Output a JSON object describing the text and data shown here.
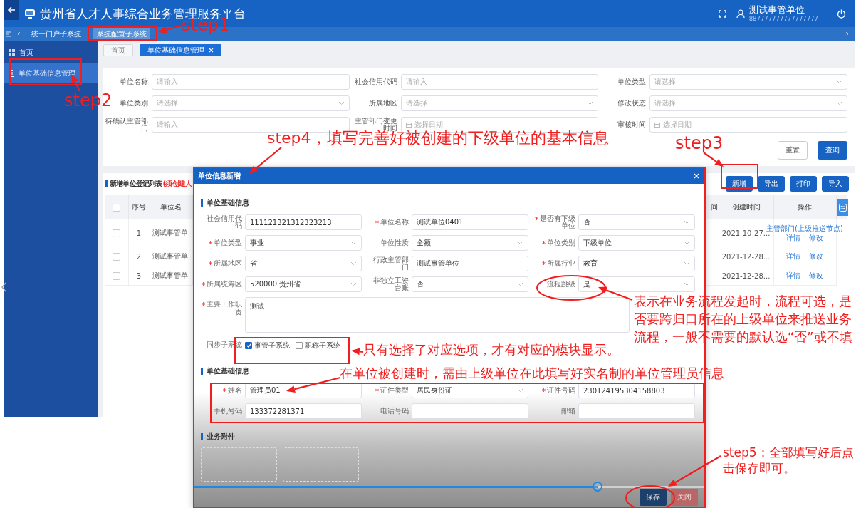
{
  "header": {
    "title": "贵州省人才人事综合业务管理服务平台",
    "user_name": "测试事管单位",
    "user_id": "887777777777777777"
  },
  "subsystem_tabs": [
    {
      "label": "统一门户子系统",
      "selected": false
    },
    {
      "label": "系统配置子系统",
      "selected": true
    }
  ],
  "sidebar": {
    "items": [
      {
        "label": "首页",
        "selected": false
      },
      {
        "label": "单位基础信息管理",
        "selected": true
      }
    ]
  },
  "page_tabs": [
    {
      "label": "首页",
      "selected": false,
      "closable": false
    },
    {
      "label": "单位基础信息管理",
      "selected": true,
      "closable": true
    }
  ],
  "search_form": {
    "fields": [
      {
        "label": "单位名称",
        "kind": "input",
        "placeholder": "请输入"
      },
      {
        "label": "社会信用代码",
        "kind": "input",
        "placeholder": "请输入"
      },
      {
        "label": "单位类型",
        "kind": "select",
        "placeholder": "请选择"
      },
      {
        "label": "单位类别",
        "kind": "select",
        "placeholder": "请选择"
      },
      {
        "label": "所属地区",
        "kind": "select",
        "placeholder": "请选择"
      },
      {
        "label": "修改状态",
        "kind": "select",
        "placeholder": "请选择"
      },
      {
        "label": "待确认主管部门",
        "kind": "input",
        "placeholder": "请输入"
      },
      {
        "label": "主管部门变更时间",
        "kind": "date",
        "placeholder": "选择日期"
      },
      {
        "label": "审核时间",
        "kind": "date",
        "placeholder": "选择日期"
      }
    ],
    "buttons": [
      {
        "label": "重置",
        "primary": false
      },
      {
        "label": "查询",
        "primary": true
      }
    ]
  },
  "list": {
    "title": "新增单位登记列表",
    "note": "(须创建人",
    "buttons": [
      "新增",
      "导出",
      "打印",
      "导入"
    ],
    "all_checked": false,
    "columns": [
      "序号",
      "单位名",
      "间",
      "创建时间",
      "操作"
    ],
    "rows": [
      {
        "checked": false,
        "index": "1",
        "name": "测试事管单",
        "created": "2021-10-27...",
        "actions": [
          "主管部门(上级推送节点)",
          "详情",
          "修改"
        ]
      },
      {
        "checked": false,
        "index": "2",
        "name": "测试事管单",
        "created": "2021-12-28...",
        "actions": [
          "详情",
          "修改"
        ]
      },
      {
        "checked": false,
        "index": "3",
        "name": "测试事管单",
        "created": "2021-12-28...",
        "actions": [
          "详情",
          "修改"
        ]
      }
    ]
  },
  "dialog": {
    "title": "单位信息新增",
    "sections": [
      {
        "kind": "form",
        "title": "单位基础信息",
        "fields": [
          {
            "label": "社会信用代码",
            "required": false,
            "kind": "input",
            "value": "111121321312323213"
          },
          {
            "label": "单位名称",
            "required": true,
            "kind": "input",
            "value": "测试单位0401"
          },
          {
            "label": "是否有下级单位",
            "required": true,
            "kind": "select",
            "value": "否"
          },
          {
            "label": "单位类型",
            "required": true,
            "kind": "select",
            "value": "事业"
          },
          {
            "label": "单位性质",
            "required": false,
            "kind": "select",
            "value": "全额"
          },
          {
            "label": "单位类别",
            "required": true,
            "kind": "select",
            "value": "下级单位"
          },
          {
            "label": "所属地区",
            "required": true,
            "kind": "select",
            "value": "省"
          },
          {
            "label": "行政主管部门",
            "required": false,
            "kind": "input",
            "value": "测试事管单位"
          },
          {
            "label": "所属行业",
            "required": true,
            "kind": "select",
            "value": "教育"
          },
          {
            "label": "所属统筹区",
            "required": true,
            "kind": "select",
            "value": "520000 贵州省"
          },
          {
            "label": "非独立工资台账",
            "required": false,
            "kind": "select",
            "value": "否"
          },
          {
            "label": "流程跳级",
            "required": false,
            "kind": "select",
            "value": "是"
          },
          {
            "label": "主要工作职责",
            "required": true,
            "kind": "textarea",
            "value": "测试"
          },
          {
            "label": "同步子系统",
            "required": false,
            "kind": "checks",
            "options": [
              {
                "label": "事管子系统",
                "checked": true
              },
              {
                "label": "职称子系统",
                "checked": false
              }
            ]
          }
        ]
      },
      {
        "kind": "form",
        "title": "单位基础信息",
        "fields": [
          {
            "label": "姓名",
            "required": true,
            "kind": "input",
            "value": "管理员01"
          },
          {
            "label": "证件类型",
            "required": true,
            "kind": "select",
            "value": "居民身份证"
          },
          {
            "label": "证件号码",
            "required": true,
            "kind": "input",
            "value": "230124195304158803"
          },
          {
            "label": "手机号码",
            "required": false,
            "kind": "input",
            "value": "133372281371"
          },
          {
            "label": "电话号码",
            "required": false,
            "kind": "input"
          },
          {
            "label": "邮箱",
            "required": false,
            "kind": "input"
          }
        ]
      },
      {
        "kind": "attachments",
        "title": "业务附件"
      }
    ],
    "buttons": [
      {
        "label": "保存",
        "kind": "primary"
      },
      {
        "label": "关闭",
        "kind": "danger"
      }
    ]
  },
  "video": {
    "progress": {
      "level": 0.79
    }
  },
  "annotations": [
    {
      "text": "step1"
    },
    {
      "text": "step2"
    },
    {
      "text": "step3"
    },
    {
      "text": "step4，填写完善好被创建的下级单位的基本信息"
    },
    {
      "text": "表示在业务流程发起时，流程可选，是否要跨归口所在的上级单位来推送业务流程，一般不需要的默认选“否”或不填"
    },
    {
      "text": "只有选择了对应选项，才有对应的模块显示。"
    },
    {
      "text": "在单位被创建时，需由上级单位在此填写好实名制的单位管理员信息"
    },
    {
      "text": "step5：全部填写好后点击保存即可。"
    }
  ]
}
